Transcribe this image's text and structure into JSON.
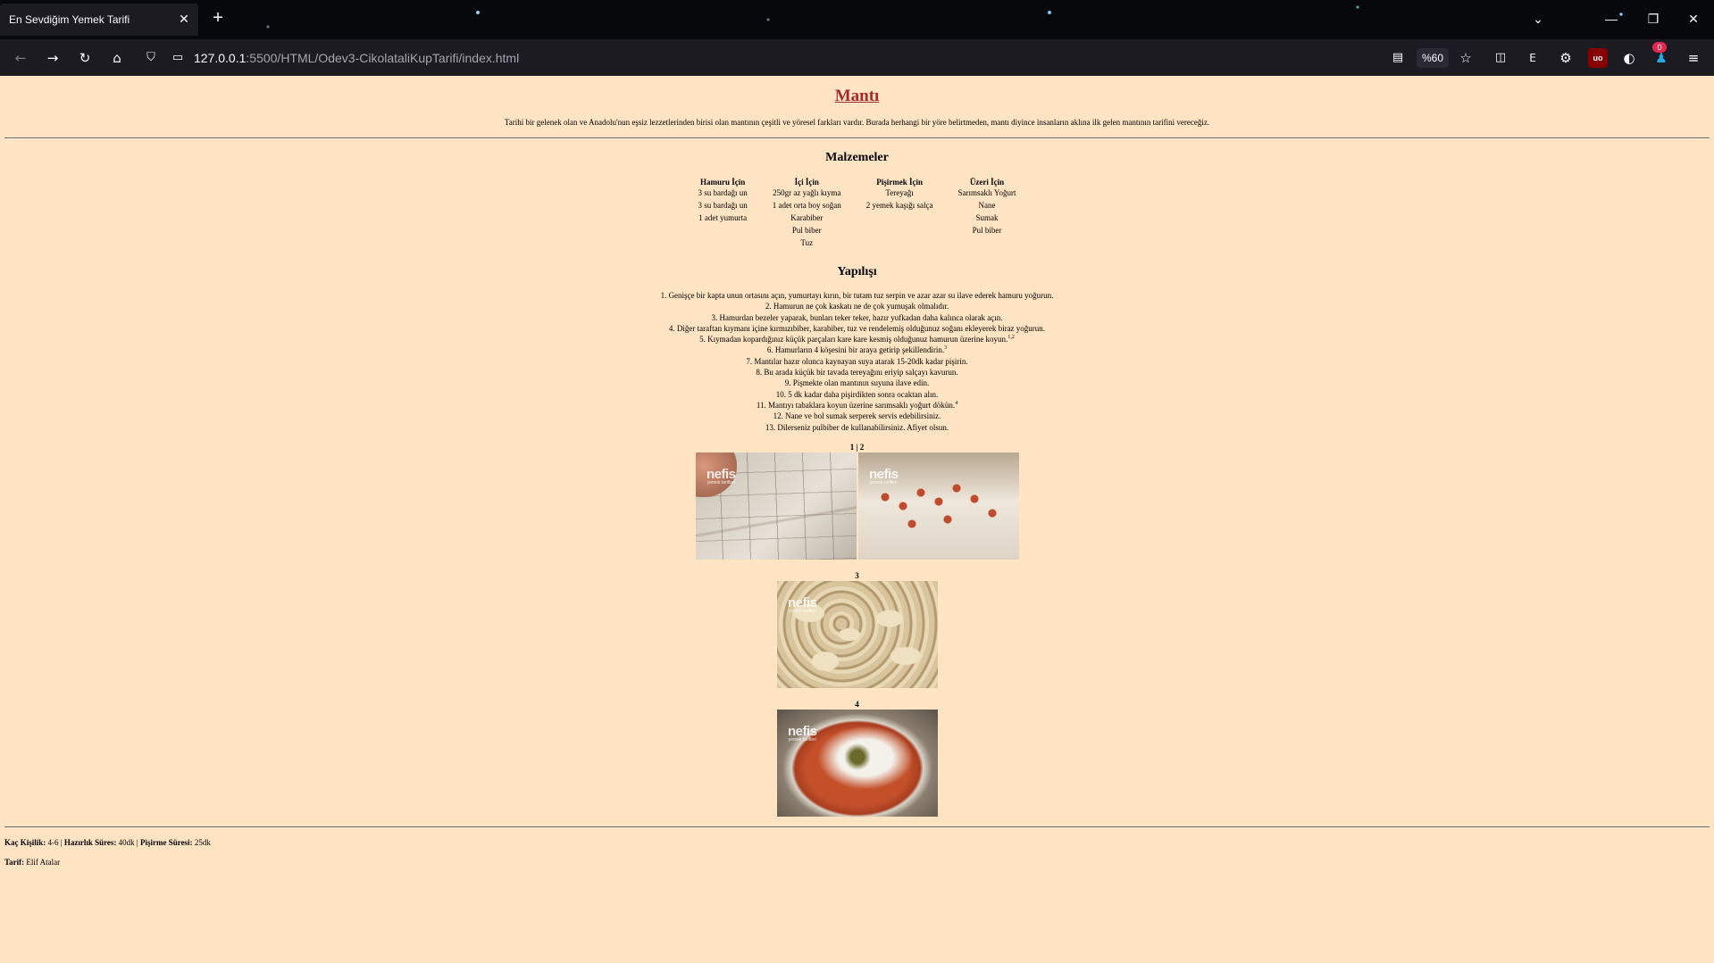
{
  "browser": {
    "tab_title": "En Sevdiğim Yemek Tarifi",
    "tab_close": "✕",
    "new_tab": "+",
    "url_host": "127.0.0.1",
    "url_rest": ":5500/HTML/Odev3-CikolataliKupTarifi/index.html",
    "zoom": "%60",
    "ext_ublock": "uo",
    "ext_badge": "0",
    "ext_e": "E"
  },
  "page": {
    "title": "Mantı",
    "intro": "Tarihi bir gelenek olan ve Anadolu'nun eşsiz lezzetlerinden birisi olan mantının çeşitli ve yöresel farkları vardır. Burada herhangi bir yöre belirtmeden, mantı diyince insanların aklına ilk gelen mantının tarifini vereceğiz.",
    "ingredients_heading": "Malzemeler",
    "ingredients": {
      "headers": [
        "Hamuru İçin",
        "İçi İçin",
        "Pişirmek İçin",
        "Üzeri İçin"
      ],
      "rows": [
        [
          "3 su bardağı un",
          "250gr az yağlı kıyma",
          "Tereyağı",
          "Sarımsaklı Yoğurt"
        ],
        [
          "3 su bardağı un",
          "1 adet orta boy soğan",
          "2 yemek kaşığı salça",
          "Nane"
        ],
        [
          "1 adet yumurta",
          "Karabiber",
          "",
          "Sumak"
        ],
        [
          "",
          "Pul biber",
          "",
          "Pul biber"
        ],
        [
          "",
          "Tuz",
          "",
          ""
        ]
      ]
    },
    "steps_heading": "Yapılışı",
    "steps": [
      {
        "num": "1.",
        "text": "Genişçe bir kapta unun ortasını açın, yumurtayı kırın, bir tutam tuz serpin ve azar azar su ilave ederek hamuru yoğurun.",
        "sup": ""
      },
      {
        "num": "2.",
        "text": "Hamurun ne çok kaskatı ne de çok yumuşak olmalıdır.",
        "sup": ""
      },
      {
        "num": "3.",
        "text": "Hamurdan bezeler yaparak, bunları teker teker, hazır yufkadan daha kalınca olarak açın.",
        "sup": ""
      },
      {
        "num": "4.",
        "text": "Diğer taraftan kıymanı içine kırmızıbiber, karabiber, tuz ve rendelemiş olduğunuz soğanı ekleyerek biraz yoğurun.",
        "sup": ""
      },
      {
        "num": "5.",
        "text": "Kıymadan kopardığınız küçük parçaları kare kare kesmiş olduğunuz hamurun üzerine koyun.",
        "sup": "1,2"
      },
      {
        "num": "6.",
        "text": "Hamurların 4 köşesini bir araya getirip şekillendirin.",
        "sup": "3"
      },
      {
        "num": "7.",
        "text": "Mantılar hazır olunca kaynayan suya atarak 15-20dk kadar pişirin.",
        "sup": ""
      },
      {
        "num": "8.",
        "text": "Bu arada küçük bir tavada tereyağını eriyip salçayı kavurun.",
        "sup": ""
      },
      {
        "num": "9.",
        "text": "Pişmekte olan mantının suyuna ilave edin.",
        "sup": ""
      },
      {
        "num": "10.",
        "text": "5 dk kadar daha pişirdikten sonra ocaktan alın.",
        "sup": ""
      },
      {
        "num": "11.",
        "text": "Mantıyı tabaklara koyun üzerine sarımsaklı yoğurt dökün.",
        "sup": "4"
      },
      {
        "num": "12.",
        "text": "Nane ve bol sumak serperek servis edebilirsiniz.",
        "sup": ""
      },
      {
        "num": "13.",
        "text": "Dilerseniz pulbiber de kullanabilirsiniz. Afiyet olsun.",
        "sup": ""
      }
    ],
    "captions": {
      "c12": "1 | 2",
      "c3": "3",
      "c4": "4"
    },
    "watermark": "nefis",
    "watermark_sub": "yemek tarifleri",
    "footer": {
      "servings_label": "Kaç Kişilik:",
      "servings_value": "4-6",
      "prep_label": "Hazırlık Süres:",
      "prep_value": "40dk",
      "cook_label": "Pişirme Süresi:",
      "cook_value": "25dk",
      "sep": "|",
      "author_label": "Tarif:",
      "author_value": "Elif Atalar"
    }
  }
}
